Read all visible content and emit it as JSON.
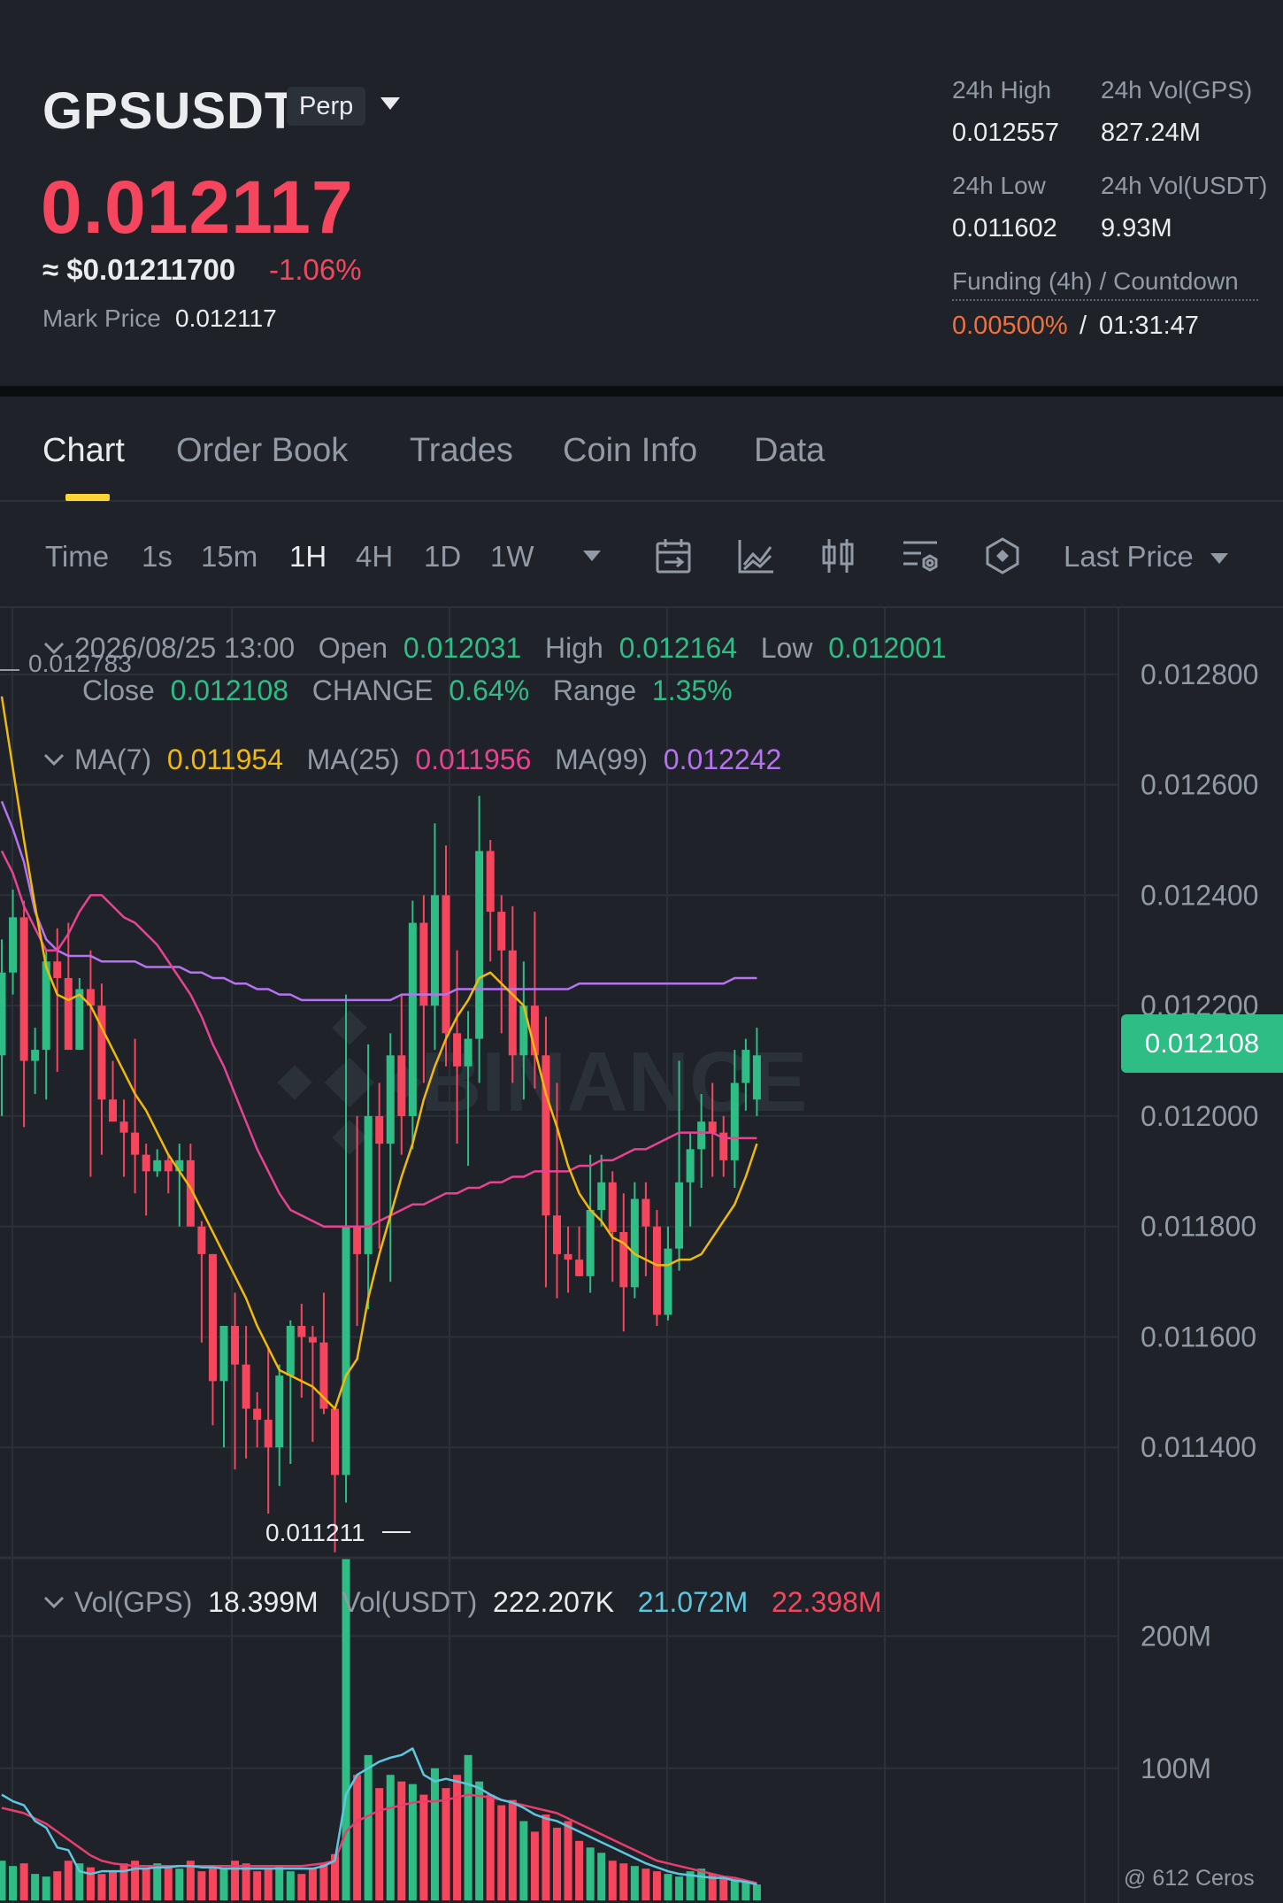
{
  "header": {
    "symbol": "GPSUSDT",
    "contract_type": "Perp",
    "last_price": "0.012117",
    "approx_usd": "≈ $0.01211700",
    "change_pct": "-1.06%",
    "mark_price_label": "Mark Price",
    "mark_price": "0.012117",
    "high_24h_label": "24h High",
    "high_24h": "0.012557",
    "vol_gps_label": "24h Vol(GPS)",
    "vol_gps": "827.24M",
    "low_24h_label": "24h Low",
    "low_24h": "0.011602",
    "vol_usdt_label": "24h Vol(USDT)",
    "vol_usdt": "9.93M",
    "funding_label": "Funding (4h) / Countdown",
    "funding_rate": "0.00500%",
    "funding_sep": "/",
    "funding_countdown": "01:31:47"
  },
  "tabs": [
    {
      "label": "Chart",
      "active": true
    },
    {
      "label": "Order Book"
    },
    {
      "label": "Trades"
    },
    {
      "label": "Coin Info"
    },
    {
      "label": "Data"
    }
  ],
  "toolbar": {
    "time_label": "Time",
    "intervals": [
      "1s",
      "15m",
      "1H",
      "4H",
      "1D",
      "1W"
    ],
    "active_interval": "1H",
    "tools": [
      "calendar-icon",
      "indicator-chart-icon",
      "candlestick-type-icon",
      "chart-settings-icon",
      "depth-icon"
    ],
    "price_type": "Last Price"
  },
  "ohlc": {
    "datetime": "2026/08/25 13:00",
    "open_label": "Open",
    "open": "0.012031",
    "high_label": "High",
    "high": "0.012164",
    "low_label": "Low",
    "low": "0.012001",
    "close_label": "Close",
    "close": "0.012108",
    "change_label": "CHANGE",
    "change": "0.64%",
    "range_label": "Range",
    "range": "1.35%"
  },
  "ma": {
    "ma7_label": "MA(7)",
    "ma7": "0.011954",
    "ma25_label": "MA(25)",
    "ma25": "0.011956",
    "ma99_label": "MA(99)",
    "ma99": "0.012242"
  },
  "volume": {
    "vol_gps_label": "Vol(GPS)",
    "vol_gps": "18.399M",
    "vol_usdt_label": "Vol(USDT)",
    "vol_usdt": "222.207K",
    "ma5": "21.072M",
    "ma10": "22.398M"
  },
  "price_axis": [
    "0.012800",
    "0.012600",
    "0.012400",
    "0.012200",
    "0.012000",
    "0.011800",
    "0.011600",
    "0.011400"
  ],
  "volume_axis": [
    "200M",
    "100M"
  ],
  "current_price_tag": "0.012108",
  "high_marker": "0.012783",
  "low_marker": "0.011211",
  "watermark_text": "BINANCE",
  "footer_watermark": "@ 612 Ceros",
  "colors": {
    "up": "#2ebd85",
    "down": "#f6465d",
    "ma7": "#f0b90b",
    "ma25": "#e84393",
    "ma99": "#b672f0",
    "accent": "#fcd535"
  },
  "chart_data": {
    "type": "candlestick",
    "interval": "1H",
    "y_range": [
      0.0112,
      0.01292
    ],
    "candles": [
      {
        "o": 0.01211,
        "h": 0.01232,
        "l": 0.012,
        "c": 0.01226
      },
      {
        "o": 0.01226,
        "h": 0.01241,
        "l": 0.01222,
        "c": 0.01236
      },
      {
        "o": 0.01236,
        "h": 0.01239,
        "l": 0.01198,
        "c": 0.0121
      },
      {
        "o": 0.0121,
        "h": 0.01216,
        "l": 0.01204,
        "c": 0.01212
      },
      {
        "o": 0.01212,
        "h": 0.0123,
        "l": 0.01203,
        "c": 0.01228
      },
      {
        "o": 0.01228,
        "h": 0.01234,
        "l": 0.01208,
        "c": 0.01225
      },
      {
        "o": 0.01225,
        "h": 0.01235,
        "l": 0.01212,
        "c": 0.01212
      },
      {
        "o": 0.01212,
        "h": 0.01225,
        "l": 0.01212,
        "c": 0.01223
      },
      {
        "o": 0.01223,
        "h": 0.0123,
        "l": 0.01189,
        "c": 0.0122
      },
      {
        "o": 0.0122,
        "h": 0.01224,
        "l": 0.01193,
        "c": 0.01203
      },
      {
        "o": 0.01203,
        "h": 0.0121,
        "l": 0.01199,
        "c": 0.01199
      },
      {
        "o": 0.01199,
        "h": 0.01203,
        "l": 0.01189,
        "c": 0.01197
      },
      {
        "o": 0.01197,
        "h": 0.01214,
        "l": 0.01186,
        "c": 0.01193
      },
      {
        "o": 0.01193,
        "h": 0.01195,
        "l": 0.01182,
        "c": 0.0119
      },
      {
        "o": 0.0119,
        "h": 0.01194,
        "l": 0.01189,
        "c": 0.01192
      },
      {
        "o": 0.01192,
        "h": 0.01193,
        "l": 0.01186,
        "c": 0.0119
      },
      {
        "o": 0.0119,
        "h": 0.01195,
        "l": 0.0118,
        "c": 0.01192
      },
      {
        "o": 0.01192,
        "h": 0.01195,
        "l": 0.0118,
        "c": 0.0118
      },
      {
        "o": 0.0118,
        "h": 0.01181,
        "l": 0.01159,
        "c": 0.01175
      },
      {
        "o": 0.01175,
        "h": 0.01175,
        "l": 0.01144,
        "c": 0.01152
      },
      {
        "o": 0.01152,
        "h": 0.01159,
        "l": 0.0114,
        "c": 0.01162
      },
      {
        "o": 0.01162,
        "h": 0.01168,
        "l": 0.01136,
        "c": 0.01155
      },
      {
        "o": 0.01155,
        "h": 0.01162,
        "l": 0.01138,
        "c": 0.01147
      },
      {
        "o": 0.01147,
        "h": 0.0115,
        "l": 0.0114,
        "c": 0.01145
      },
      {
        "o": 0.01145,
        "h": 0.01158,
        "l": 0.01128,
        "c": 0.0114
      },
      {
        "o": 0.0114,
        "h": 0.01155,
        "l": 0.01133,
        "c": 0.01153
      },
      {
        "o": 0.01153,
        "h": 0.01163,
        "l": 0.01137,
        "c": 0.01162
      },
      {
        "o": 0.01162,
        "h": 0.01166,
        "l": 0.01149,
        "c": 0.0116
      },
      {
        "o": 0.0116,
        "h": 0.01162,
        "l": 0.01141,
        "c": 0.01159
      },
      {
        "o": 0.01159,
        "h": 0.01168,
        "l": 0.01146,
        "c": 0.01147
      },
      {
        "o": 0.01147,
        "h": 0.01147,
        "l": 0.01121,
        "c": 0.01135
      },
      {
        "o": 0.01135,
        "h": 0.01222,
        "l": 0.0113,
        "c": 0.0118
      },
      {
        "o": 0.0118,
        "h": 0.012,
        "l": 0.01162,
        "c": 0.01175
      },
      {
        "o": 0.01175,
        "h": 0.01213,
        "l": 0.01165,
        "c": 0.012
      },
      {
        "o": 0.012,
        "h": 0.01206,
        "l": 0.01176,
        "c": 0.01195
      },
      {
        "o": 0.01195,
        "h": 0.01215,
        "l": 0.0117,
        "c": 0.01211
      },
      {
        "o": 0.01211,
        "h": 0.01222,
        "l": 0.01193,
        "c": 0.012
      },
      {
        "o": 0.012,
        "h": 0.01239,
        "l": 0.01194,
        "c": 0.01235
      },
      {
        "o": 0.01235,
        "h": 0.0124,
        "l": 0.01206,
        "c": 0.0122
      },
      {
        "o": 0.0122,
        "h": 0.01253,
        "l": 0.01212,
        "c": 0.0124
      },
      {
        "o": 0.0124,
        "h": 0.01249,
        "l": 0.01209,
        "c": 0.01215
      },
      {
        "o": 0.01215,
        "h": 0.0123,
        "l": 0.01195,
        "c": 0.01209
      },
      {
        "o": 0.01209,
        "h": 0.01219,
        "l": 0.01191,
        "c": 0.01214
      },
      {
        "o": 0.01214,
        "h": 0.01258,
        "l": 0.01206,
        "c": 0.01248
      },
      {
        "o": 0.01248,
        "h": 0.0125,
        "l": 0.01228,
        "c": 0.01237
      },
      {
        "o": 0.01237,
        "h": 0.0124,
        "l": 0.01215,
        "c": 0.0123
      },
      {
        "o": 0.0123,
        "h": 0.01238,
        "l": 0.01206,
        "c": 0.01211
      },
      {
        "o": 0.01211,
        "h": 0.01228,
        "l": 0.01203,
        "c": 0.0122
      },
      {
        "o": 0.0122,
        "h": 0.01237,
        "l": 0.01205,
        "c": 0.01211
      },
      {
        "o": 0.01211,
        "h": 0.01218,
        "l": 0.01169,
        "c": 0.01182
      },
      {
        "o": 0.01182,
        "h": 0.01206,
        "l": 0.01167,
        "c": 0.01175
      },
      {
        "o": 0.01175,
        "h": 0.0118,
        "l": 0.01168,
        "c": 0.01174
      },
      {
        "o": 0.01174,
        "h": 0.0118,
        "l": 0.01171,
        "c": 0.01171
      },
      {
        "o": 0.01171,
        "h": 0.01193,
        "l": 0.01168,
        "c": 0.01183
      },
      {
        "o": 0.01183,
        "h": 0.01193,
        "l": 0.0118,
        "c": 0.01188
      },
      {
        "o": 0.01188,
        "h": 0.0119,
        "l": 0.0117,
        "c": 0.01179
      },
      {
        "o": 0.01179,
        "h": 0.01186,
        "l": 0.01161,
        "c": 0.01169
      },
      {
        "o": 0.01169,
        "h": 0.01188,
        "l": 0.01167,
        "c": 0.01185
      },
      {
        "o": 0.01185,
        "h": 0.01188,
        "l": 0.01171,
        "c": 0.0118
      },
      {
        "o": 0.0118,
        "h": 0.01183,
        "l": 0.01162,
        "c": 0.01164
      },
      {
        "o": 0.01164,
        "h": 0.0118,
        "l": 0.01163,
        "c": 0.01176
      },
      {
        "o": 0.01176,
        "h": 0.0121,
        "l": 0.01172,
        "c": 0.01188
      },
      {
        "o": 0.01188,
        "h": 0.01197,
        "l": 0.0118,
        "c": 0.01194
      },
      {
        "o": 0.01194,
        "h": 0.01204,
        "l": 0.01187,
        "c": 0.01199
      },
      {
        "o": 0.01199,
        "h": 0.01206,
        "l": 0.01189,
        "c": 0.01197
      },
      {
        "o": 0.01197,
        "h": 0.012,
        "l": 0.01189,
        "c": 0.01192
      },
      {
        "o": 0.01192,
        "h": 0.01212,
        "l": 0.01187,
        "c": 0.01206
      },
      {
        "o": 0.01206,
        "h": 0.01214,
        "l": 0.01201,
        "c": 0.01212
      },
      {
        "o": 0.01203,
        "h": 0.01216,
        "l": 0.012,
        "c": 0.01211
      }
    ],
    "ma7": [
      0.01276,
      0.01263,
      0.0125,
      0.01238,
      0.01227,
      0.01222,
      0.01221,
      0.01222,
      0.0122,
      0.01216,
      0.01212,
      0.01208,
      0.01204,
      0.01201,
      0.01197,
      0.01193,
      0.0119,
      0.01187,
      0.01183,
      0.01179,
      0.01175,
      0.01171,
      0.01167,
      0.01162,
      0.01158,
      0.01154,
      0.01153,
      0.01152,
      0.01151,
      0.01149,
      0.01147,
      0.01153,
      0.01156,
      0.01167,
      0.01175,
      0.01182,
      0.01189,
      0.01195,
      0.01203,
      0.01209,
      0.01214,
      0.01218,
      0.01221,
      0.01225,
      0.01226,
      0.01224,
      0.01222,
      0.0122,
      0.01212,
      0.01204,
      0.01198,
      0.01191,
      0.01186,
      0.01183,
      0.01181,
      0.01178,
      0.01177,
      0.01175,
      0.01174,
      0.01173,
      0.01173,
      0.01174,
      0.01174,
      0.01175,
      0.01178,
      0.01181,
      0.01184,
      0.01189,
      0.01195
    ],
    "ma25": [
      0.01248,
      0.01244,
      0.01238,
      0.01234,
      0.0123,
      0.0123,
      0.01233,
      0.01237,
      0.0124,
      0.0124,
      0.01238,
      0.01236,
      0.01235,
      0.01233,
      0.01231,
      0.01228,
      0.01225,
      0.01222,
      0.01218,
      0.01213,
      0.01209,
      0.01204,
      0.01199,
      0.01194,
      0.0119,
      0.01186,
      0.01183,
      0.01182,
      0.01181,
      0.0118,
      0.0118,
      0.0118,
      0.0118,
      0.0118,
      0.01181,
      0.01182,
      0.01183,
      0.01184,
      0.01184,
      0.01185,
      0.01186,
      0.01186,
      0.01187,
      0.01187,
      0.01188,
      0.01188,
      0.01189,
      0.01189,
      0.0119,
      0.0119,
      0.0119,
      0.0119,
      0.01191,
      0.01191,
      0.01192,
      0.01192,
      0.01193,
      0.01194,
      0.01194,
      0.01195,
      0.01196,
      0.01197,
      0.01197,
      0.01197,
      0.01197,
      0.01196,
      0.01196,
      0.01196,
      0.01196
    ],
    "ma99": [
      0.01257,
      0.01252,
      0.01246,
      0.01237,
      0.01232,
      0.0123,
      0.01229,
      0.01229,
      0.01229,
      0.01228,
      0.01228,
      0.01228,
      0.01228,
      0.01227,
      0.01227,
      0.01227,
      0.01227,
      0.01226,
      0.01226,
      0.01225,
      0.01225,
      0.01224,
      0.01224,
      0.01223,
      0.01223,
      0.01222,
      0.01222,
      0.01221,
      0.01221,
      0.01221,
      0.01221,
      0.01221,
      0.01221,
      0.01221,
      0.01221,
      0.01221,
      0.01222,
      0.01222,
      0.01222,
      0.01222,
      0.01222,
      0.01223,
      0.01223,
      0.01223,
      0.01223,
      0.01223,
      0.01223,
      0.01223,
      0.01223,
      0.01223,
      0.01223,
      0.01223,
      0.01224,
      0.01224,
      0.01224,
      0.01224,
      0.01224,
      0.01224,
      0.01224,
      0.01224,
      0.01224,
      0.01224,
      0.01224,
      0.01224,
      0.01224,
      0.01224,
      0.01225,
      0.01225,
      0.01225
    ],
    "volume_range": [
      0,
      260
    ],
    "volumes": [
      30,
      26,
      28,
      20,
      18,
      22,
      30,
      28,
      25,
      20,
      22,
      28,
      30,
      24,
      28,
      26,
      24,
      30,
      22,
      26,
      24,
      30,
      28,
      22,
      24,
      26,
      22,
      20,
      24,
      28,
      35,
      260,
      95,
      110,
      85,
      95,
      90,
      88,
      80,
      100,
      85,
      95,
      110,
      90,
      80,
      72,
      76,
      60,
      52,
      65,
      55,
      60,
      45,
      40,
      36,
      30,
      28,
      26,
      24,
      22,
      20,
      18,
      22,
      24,
      20,
      18,
      16,
      14,
      12
    ],
    "vol_ma5": [
      80,
      75,
      72,
      60,
      55,
      40,
      38,
      22,
      20,
      22,
      22,
      22,
      24,
      24,
      25,
      25,
      26,
      26,
      25,
      25,
      24,
      24,
      24,
      24,
      24,
      24,
      24,
      24,
      24,
      26,
      30,
      80,
      95,
      100,
      105,
      108,
      110,
      115,
      95,
      90,
      92,
      90,
      88,
      85,
      80,
      76,
      74,
      70,
      65,
      62,
      60,
      56,
      52,
      48,
      44,
      40,
      36,
      32,
      28,
      25,
      22,
      20,
      19,
      18,
      17,
      17,
      15,
      14,
      12
    ],
    "vol_ma10": [
      70,
      68,
      66,
      62,
      58,
      52,
      46,
      40,
      34,
      30,
      28,
      27,
      26,
      26,
      26,
      26,
      26,
      26,
      26,
      26,
      26,
      26,
      26,
      26,
      26,
      26,
      26,
      26,
      27,
      28,
      30,
      52,
      60,
      64,
      68,
      70,
      72,
      74,
      75,
      75,
      76,
      78,
      80,
      79,
      78,
      76,
      74,
      72,
      70,
      68,
      66,
      62,
      58,
      54,
      50,
      46,
      42,
      38,
      34,
      30,
      28,
      26,
      24,
      22,
      20,
      18,
      17,
      15,
      13
    ]
  }
}
